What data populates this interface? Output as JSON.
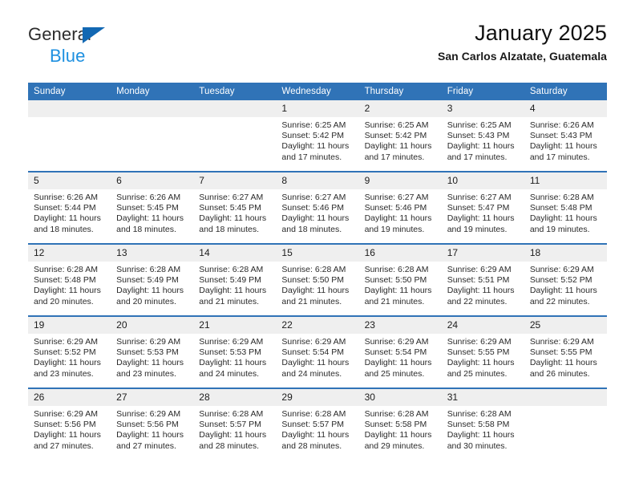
{
  "brand": {
    "name_part1": "General",
    "name_part2": "Blue",
    "triangle_icon": "triangle-icon",
    "accent_color": "#1268b3",
    "blue_text_color": "#1e90e0"
  },
  "header": {
    "title": "January 2025",
    "subtitle": "San Carlos Alzatate, Guatemala"
  },
  "calendar": {
    "header_bg_color": "#3073b7",
    "header_text_color": "#ffffff",
    "daynum_bg_color": "#efefef",
    "weekday_headers": [
      "Sunday",
      "Monday",
      "Tuesday",
      "Wednesday",
      "Thursday",
      "Friday",
      "Saturday"
    ],
    "weeks": [
      [
        {
          "day": "",
          "empty": true
        },
        {
          "day": "",
          "empty": true
        },
        {
          "day": "",
          "empty": true
        },
        {
          "day": "1",
          "sunrise": "Sunrise: 6:25 AM",
          "sunset": "Sunset: 5:42 PM",
          "daylight": "Daylight: 11 hours and 17 minutes."
        },
        {
          "day": "2",
          "sunrise": "Sunrise: 6:25 AM",
          "sunset": "Sunset: 5:42 PM",
          "daylight": "Daylight: 11 hours and 17 minutes."
        },
        {
          "day": "3",
          "sunrise": "Sunrise: 6:25 AM",
          "sunset": "Sunset: 5:43 PM",
          "daylight": "Daylight: 11 hours and 17 minutes."
        },
        {
          "day": "4",
          "sunrise": "Sunrise: 6:26 AM",
          "sunset": "Sunset: 5:43 PM",
          "daylight": "Daylight: 11 hours and 17 minutes."
        }
      ],
      [
        {
          "day": "5",
          "sunrise": "Sunrise: 6:26 AM",
          "sunset": "Sunset: 5:44 PM",
          "daylight": "Daylight: 11 hours and 18 minutes."
        },
        {
          "day": "6",
          "sunrise": "Sunrise: 6:26 AM",
          "sunset": "Sunset: 5:45 PM",
          "daylight": "Daylight: 11 hours and 18 minutes."
        },
        {
          "day": "7",
          "sunrise": "Sunrise: 6:27 AM",
          "sunset": "Sunset: 5:45 PM",
          "daylight": "Daylight: 11 hours and 18 minutes."
        },
        {
          "day": "8",
          "sunrise": "Sunrise: 6:27 AM",
          "sunset": "Sunset: 5:46 PM",
          "daylight": "Daylight: 11 hours and 18 minutes."
        },
        {
          "day": "9",
          "sunrise": "Sunrise: 6:27 AM",
          "sunset": "Sunset: 5:46 PM",
          "daylight": "Daylight: 11 hours and 19 minutes."
        },
        {
          "day": "10",
          "sunrise": "Sunrise: 6:27 AM",
          "sunset": "Sunset: 5:47 PM",
          "daylight": "Daylight: 11 hours and 19 minutes."
        },
        {
          "day": "11",
          "sunrise": "Sunrise: 6:28 AM",
          "sunset": "Sunset: 5:48 PM",
          "daylight": "Daylight: 11 hours and 19 minutes."
        }
      ],
      [
        {
          "day": "12",
          "sunrise": "Sunrise: 6:28 AM",
          "sunset": "Sunset: 5:48 PM",
          "daylight": "Daylight: 11 hours and 20 minutes."
        },
        {
          "day": "13",
          "sunrise": "Sunrise: 6:28 AM",
          "sunset": "Sunset: 5:49 PM",
          "daylight": "Daylight: 11 hours and 20 minutes."
        },
        {
          "day": "14",
          "sunrise": "Sunrise: 6:28 AM",
          "sunset": "Sunset: 5:49 PM",
          "daylight": "Daylight: 11 hours and 21 minutes."
        },
        {
          "day": "15",
          "sunrise": "Sunrise: 6:28 AM",
          "sunset": "Sunset: 5:50 PM",
          "daylight": "Daylight: 11 hours and 21 minutes."
        },
        {
          "day": "16",
          "sunrise": "Sunrise: 6:28 AM",
          "sunset": "Sunset: 5:50 PM",
          "daylight": "Daylight: 11 hours and 21 minutes."
        },
        {
          "day": "17",
          "sunrise": "Sunrise: 6:29 AM",
          "sunset": "Sunset: 5:51 PM",
          "daylight": "Daylight: 11 hours and 22 minutes."
        },
        {
          "day": "18",
          "sunrise": "Sunrise: 6:29 AM",
          "sunset": "Sunset: 5:52 PM",
          "daylight": "Daylight: 11 hours and 22 minutes."
        }
      ],
      [
        {
          "day": "19",
          "sunrise": "Sunrise: 6:29 AM",
          "sunset": "Sunset: 5:52 PM",
          "daylight": "Daylight: 11 hours and 23 minutes."
        },
        {
          "day": "20",
          "sunrise": "Sunrise: 6:29 AM",
          "sunset": "Sunset: 5:53 PM",
          "daylight": "Daylight: 11 hours and 23 minutes."
        },
        {
          "day": "21",
          "sunrise": "Sunrise: 6:29 AM",
          "sunset": "Sunset: 5:53 PM",
          "daylight": "Daylight: 11 hours and 24 minutes."
        },
        {
          "day": "22",
          "sunrise": "Sunrise: 6:29 AM",
          "sunset": "Sunset: 5:54 PM",
          "daylight": "Daylight: 11 hours and 24 minutes."
        },
        {
          "day": "23",
          "sunrise": "Sunrise: 6:29 AM",
          "sunset": "Sunset: 5:54 PM",
          "daylight": "Daylight: 11 hours and 25 minutes."
        },
        {
          "day": "24",
          "sunrise": "Sunrise: 6:29 AM",
          "sunset": "Sunset: 5:55 PM",
          "daylight": "Daylight: 11 hours and 25 minutes."
        },
        {
          "day": "25",
          "sunrise": "Sunrise: 6:29 AM",
          "sunset": "Sunset: 5:55 PM",
          "daylight": "Daylight: 11 hours and 26 minutes."
        }
      ],
      [
        {
          "day": "26",
          "sunrise": "Sunrise: 6:29 AM",
          "sunset": "Sunset: 5:56 PM",
          "daylight": "Daylight: 11 hours and 27 minutes."
        },
        {
          "day": "27",
          "sunrise": "Sunrise: 6:29 AM",
          "sunset": "Sunset: 5:56 PM",
          "daylight": "Daylight: 11 hours and 27 minutes."
        },
        {
          "day": "28",
          "sunrise": "Sunrise: 6:28 AM",
          "sunset": "Sunset: 5:57 PM",
          "daylight": "Daylight: 11 hours and 28 minutes."
        },
        {
          "day": "29",
          "sunrise": "Sunrise: 6:28 AM",
          "sunset": "Sunset: 5:57 PM",
          "daylight": "Daylight: 11 hours and 28 minutes."
        },
        {
          "day": "30",
          "sunrise": "Sunrise: 6:28 AM",
          "sunset": "Sunset: 5:58 PM",
          "daylight": "Daylight: 11 hours and 29 minutes."
        },
        {
          "day": "31",
          "sunrise": "Sunrise: 6:28 AM",
          "sunset": "Sunset: 5:58 PM",
          "daylight": "Daylight: 11 hours and 30 minutes."
        },
        {
          "day": "",
          "empty": true
        }
      ]
    ]
  }
}
